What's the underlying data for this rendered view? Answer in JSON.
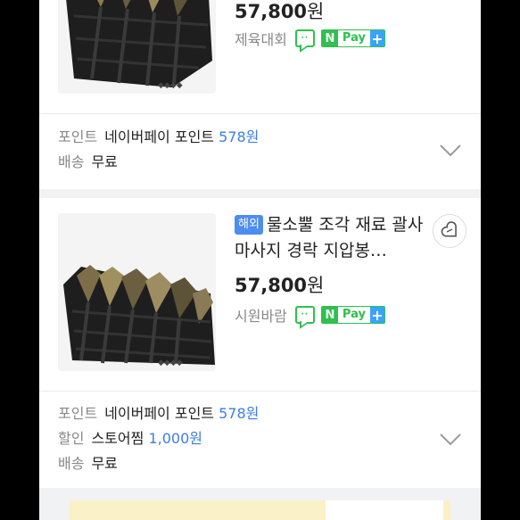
{
  "products": [
    {
      "price_value": "57,800",
      "price_unit": "원",
      "seller": "제육대회",
      "npay": "N",
      "npay_text": "Pay",
      "npay_plus": "+",
      "points_label": "포인트",
      "points_text": "네이버페이 포인트",
      "points_value": "578원",
      "shipping_label": "배송",
      "shipping_value": "무료"
    },
    {
      "badge": "해외",
      "title": "물소뿔 조각 재료 괄사 마사지 경락 지압봉…",
      "price_value": "57,800",
      "price_unit": "원",
      "seller": "시원바람",
      "npay": "N",
      "npay_text": "Pay",
      "npay_plus": "+",
      "points_label": "포인트",
      "points_text": "네이버페이 포인트",
      "points_value": "578원",
      "discount_label": "할인",
      "discount_text": "스토어찜",
      "discount_value": "1,000원",
      "shipping_label": "배송",
      "shipping_value": "무료"
    }
  ],
  "colors": {
    "accent_blue": "#3d7ee8",
    "npay_green": "#2fc04d",
    "badge_blue": "#4d8cf0"
  },
  "icons": {
    "favorite": "heart-icon",
    "talk": "talk-icon",
    "expand": "chevron-down-icon"
  }
}
